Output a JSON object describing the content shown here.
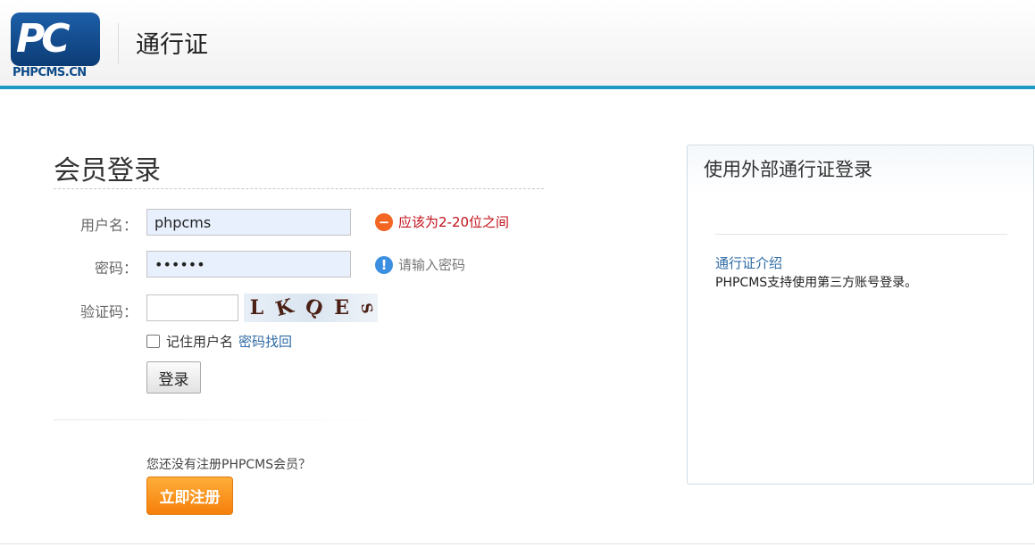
{
  "header": {
    "logo_letters": "PC",
    "logo_text": "PHPCMS.CN",
    "title": "通行证"
  },
  "login": {
    "title": "会员登录",
    "username_label": "用户名：",
    "username_value": "phpcms",
    "username_error": "应该为2-20位之间",
    "password_label": "密码：",
    "password_value": "••••••",
    "password_hint": "请输入密码",
    "captcha_label": "验证码：",
    "captcha_value": "",
    "captcha_chars": [
      "L",
      "K",
      "Q",
      "E",
      "S"
    ],
    "remember_label": "记住用户名",
    "forgot_link": "密码找回",
    "login_button": "登录",
    "no_account_text": "您还没有注册PHPCMS会员？",
    "register_button": "立即注册"
  },
  "external": {
    "title": "使用外部通行证登录",
    "intro_link": "通行证介绍",
    "description": "PHPCMS支持使用第三方账号登录。"
  },
  "colors": {
    "header_accent": "#1a9ac5",
    "error_red": "#c0111a",
    "link_blue": "#2d6aa4",
    "register_orange": "#f57f0a",
    "input_bg": "#e8f0fe"
  },
  "icons": {
    "error": "minus-circle-icon",
    "hint": "info-circle-icon"
  }
}
